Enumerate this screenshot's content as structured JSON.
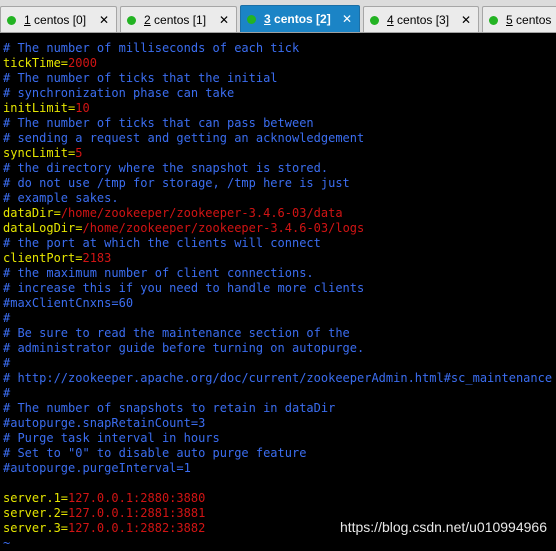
{
  "tabs": [
    {
      "num": "1",
      "label": " centos [0]",
      "close": "✕",
      "active": false
    },
    {
      "num": "2",
      "label": " centos [1]",
      "close": "✕",
      "active": false
    },
    {
      "num": "3",
      "label": " centos [2]",
      "close": "✕",
      "active": true
    },
    {
      "num": "4",
      "label": " centos [3]",
      "close": "✕",
      "active": false
    },
    {
      "num": "5",
      "label": " centos",
      "close": "",
      "active": false
    }
  ],
  "status_colors": {
    "connected_dot": "#23b323",
    "active_tab": "#1b84c6"
  },
  "terminal": {
    "colors": {
      "comment": "#3b6df0",
      "key": "#e6e600",
      "value": "#d11414",
      "background": "#000000"
    },
    "lines": [
      {
        "type": "comment",
        "text": "# The number of milliseconds of each tick"
      },
      {
        "type": "kv",
        "key": "tickTime",
        "value": "2000"
      },
      {
        "type": "comment",
        "text": "# The number of ticks that the initial"
      },
      {
        "type": "comment",
        "text": "# synchronization phase can take"
      },
      {
        "type": "kv",
        "key": "initLimit",
        "value": "10"
      },
      {
        "type": "comment",
        "text": "# The number of ticks that can pass between"
      },
      {
        "type": "comment",
        "text": "# sending a request and getting an acknowledgement"
      },
      {
        "type": "kv",
        "key": "syncLimit",
        "value": "5"
      },
      {
        "type": "comment",
        "text": "# the directory where the snapshot is stored."
      },
      {
        "type": "comment",
        "text": "# do not use /tmp for storage, /tmp here is just"
      },
      {
        "type": "comment",
        "text": "# example sakes."
      },
      {
        "type": "kv",
        "key": "dataDir",
        "value": "/home/zookeeper/zookeeper-3.4.6-03/data"
      },
      {
        "type": "kv",
        "key": "dataLogDir",
        "value": "/home/zookeeper/zookeeper-3.4.6-03/logs"
      },
      {
        "type": "comment",
        "text": "# the port at which the clients will connect"
      },
      {
        "type": "kv",
        "key": "clientPort",
        "value": "2183"
      },
      {
        "type": "comment",
        "text": "# the maximum number of client connections."
      },
      {
        "type": "comment",
        "text": "# increase this if you need to handle more clients"
      },
      {
        "type": "comment",
        "text": "#maxClientCnxns=60"
      },
      {
        "type": "comment",
        "text": "#"
      },
      {
        "type": "comment",
        "text": "# Be sure to read the maintenance section of the"
      },
      {
        "type": "comment",
        "text": "# administrator guide before turning on autopurge."
      },
      {
        "type": "comment",
        "text": "#"
      },
      {
        "type": "comment",
        "text": "# http://zookeeper.apache.org/doc/current/zookeeperAdmin.html#sc_maintenance"
      },
      {
        "type": "comment",
        "text": "#"
      },
      {
        "type": "comment",
        "text": "# The number of snapshots to retain in dataDir"
      },
      {
        "type": "comment",
        "text": "#autopurge.snapRetainCount=3"
      },
      {
        "type": "comment",
        "text": "# Purge task interval in hours"
      },
      {
        "type": "comment",
        "text": "# Set to \"0\" to disable auto purge feature"
      },
      {
        "type": "comment",
        "text": "#autopurge.purgeInterval=1"
      },
      {
        "type": "blank",
        "text": ""
      },
      {
        "type": "kv",
        "key": "server.1",
        "value": "127.0.0.1:2880:3880"
      },
      {
        "type": "kv",
        "key": "server.2",
        "value": "127.0.0.1:2881:3881"
      },
      {
        "type": "kv",
        "key": "server.3",
        "value": "127.0.0.1:2882:3882"
      },
      {
        "type": "tilde",
        "text": "~"
      }
    ]
  },
  "watermark": "https://blog.csdn.net/u010994966"
}
